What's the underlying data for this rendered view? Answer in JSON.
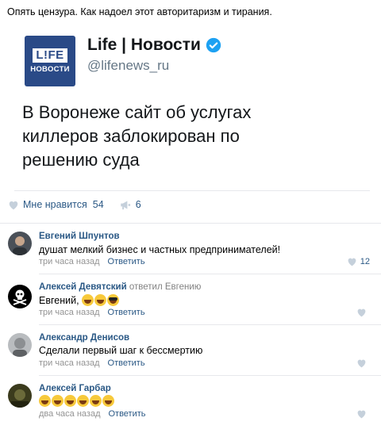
{
  "post": {
    "text": "Опять цензура. Как надоел этот авторитаризм и тирания."
  },
  "embed": {
    "logo_top": "L!FE",
    "logo_bottom": "НОВОСТИ",
    "name": "Life | Новости",
    "handle": "@lifenews_ru",
    "body": "В Воронеже сайт об услугах киллеров заблокирован по решению суда"
  },
  "actions": {
    "like_label": "Мне нравится",
    "like_count": "54",
    "share_count": "6"
  },
  "comments": [
    {
      "author": "Евгений Шпунтов",
      "reply_to": "",
      "text": "душат мелкий бизнес и частных предпринимателей!",
      "time": "три часа назад",
      "reply_label": "Ответить",
      "likes": "12"
    },
    {
      "author": "Алексей Девятский",
      "reply_to": "ответил Евгению",
      "text": "Евгений,",
      "time": "три часа назад",
      "reply_label": "Ответить",
      "likes": ""
    },
    {
      "author": "Александр Денисов",
      "reply_to": "",
      "text": "Сделали первый шаг к бессмертию",
      "time": "три часа назад",
      "reply_label": "Ответить",
      "likes": ""
    },
    {
      "author": "Алексей Гарбар",
      "reply_to": "",
      "text": "",
      "time": "два часа назад",
      "reply_label": "Ответить",
      "likes": ""
    }
  ],
  "colors": {
    "link": "#2a5885",
    "verified": "#1da1f2",
    "logo_bg": "#2a4a87",
    "meta": "#939393"
  }
}
